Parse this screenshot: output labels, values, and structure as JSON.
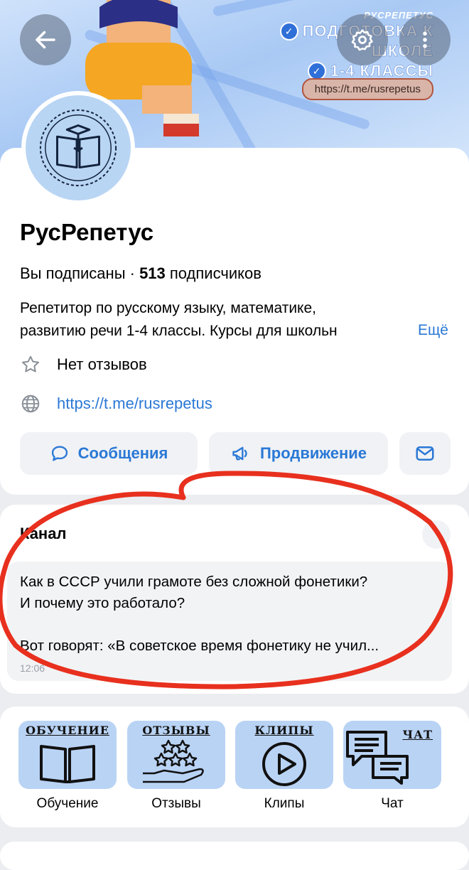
{
  "cover": {
    "brand": "РУСРЕПЕТУС",
    "promo_line1": "ПОДГОТОВКА К",
    "promo_line2": "ШКОЛЕ",
    "promo_line3": "1-4 КЛАССЫ",
    "promo_link": "https://t.me/rusrepetus"
  },
  "profile": {
    "name": "РусРепетус",
    "subscribed_text": "Вы подписаны · ",
    "subscribers_count": "513",
    "subscribers_label": " подписчиков",
    "description_line1": "Репетитор по русскому языку, математике,",
    "description_line2": "развитию речи 1-4 классы. Курсы для школьн",
    "more_label": "Ещё",
    "reviews_text": "Нет отзывов",
    "website": "https://t.me/rusrepetus"
  },
  "actions": {
    "messages": "Сообщения",
    "promotion": "Продвижение"
  },
  "channel": {
    "title": "Канал",
    "post_line1": "Как в СССР учили грамоте без сложной фонетики?",
    "post_line2": "И почему это работало?",
    "post_line3": "Вот говорят: «В советское время фонетику не учил...",
    "post_date": "12:06"
  },
  "tiles": [
    {
      "caption": "ОБУЧЕНИЕ",
      "label": "Обучение"
    },
    {
      "caption": "ОТЗЫВЫ",
      "label": "Отзывы"
    },
    {
      "caption": "КЛИПЫ",
      "label": "Клипы"
    },
    {
      "caption": "ЧАТ",
      "label": "Чат"
    }
  ],
  "colors": {
    "accent": "#2a78d6",
    "annotation": "#e8301e",
    "tile_bg": "#b9d3f4"
  },
  "icons": [
    "back-arrow-icon",
    "gear-icon",
    "more-vertical-icon",
    "star-icon",
    "globe-icon",
    "chat-bubble-icon",
    "megaphone-icon",
    "mail-icon",
    "book-icon",
    "stars-hand-icon",
    "play-icon",
    "chat-bubbles-icon"
  ]
}
